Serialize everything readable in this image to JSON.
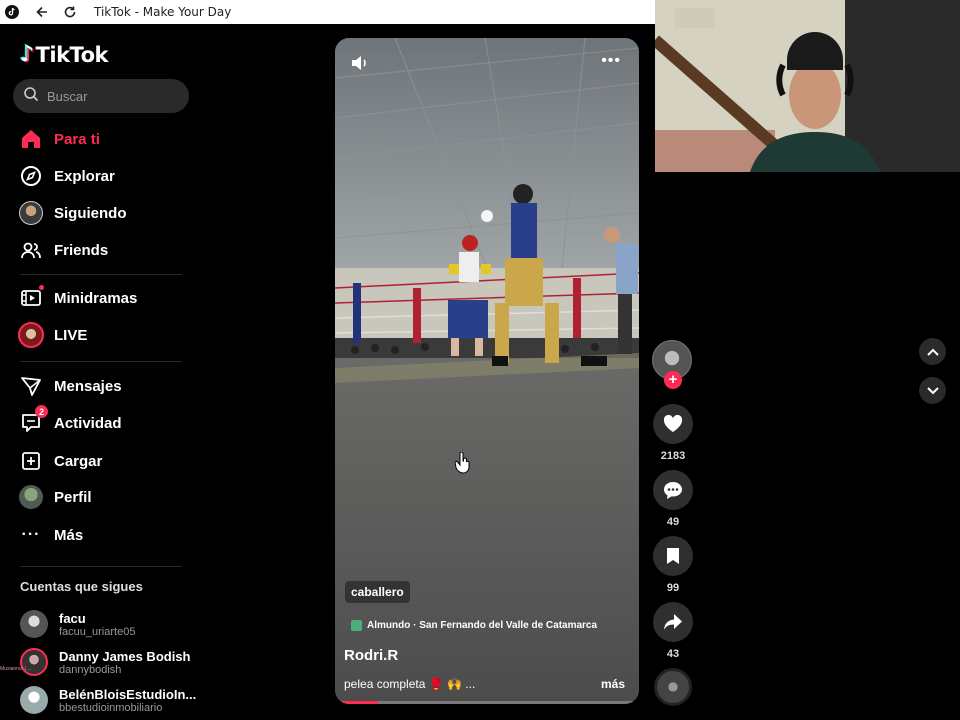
{
  "browser": {
    "title": "TikTok - Make Your Day"
  },
  "sidebar": {
    "logo_text": "TikTok",
    "search_placeholder": "Buscar",
    "nav": [
      {
        "label": "Para ti",
        "icon": "home-icon",
        "active": true
      },
      {
        "label": "Explorar",
        "icon": "compass-icon"
      },
      {
        "label": "Siguiendo",
        "icon": "following-avatar-icon"
      },
      {
        "label": "Friends",
        "icon": "friends-icon"
      },
      {
        "label": "Minidramas",
        "icon": "film-icon"
      },
      {
        "label": "LIVE",
        "icon": "live-avatar-icon"
      },
      {
        "label": "Mensajes",
        "icon": "send-icon"
      },
      {
        "label": "Actividad",
        "icon": "activity-icon",
        "badge": "2"
      },
      {
        "label": "Cargar",
        "icon": "upload-icon"
      },
      {
        "label": "Perfil",
        "icon": "profile-avatar-icon"
      },
      {
        "label": "Más",
        "icon": "more-dots-icon"
      }
    ],
    "following_title": "Cuentas que sigues",
    "accounts": [
      {
        "name": "facu",
        "handle": "facuu_uriarte05"
      },
      {
        "name": "Danny James Bodish",
        "handle": "dannybodish"
      },
      {
        "name": "BelénBloisEstudioIn...",
        "handle": "bbestudioinmobiliario"
      }
    ],
    "stream_chat_overlay": "Muxiannu: | ... "
  },
  "video": {
    "tag": "caballero",
    "location": "Almundo · San Fernando del Valle de Catamarca",
    "author": "Rodri.R",
    "description": "pelea completa 🥊 🙌 ...",
    "more_label": "más",
    "progress": 0.14
  },
  "actions": {
    "likes": "2183",
    "comments": "49",
    "saves": "99",
    "shares": "43"
  },
  "colors": {
    "accent": "#fe2c55",
    "background": "#000000"
  }
}
